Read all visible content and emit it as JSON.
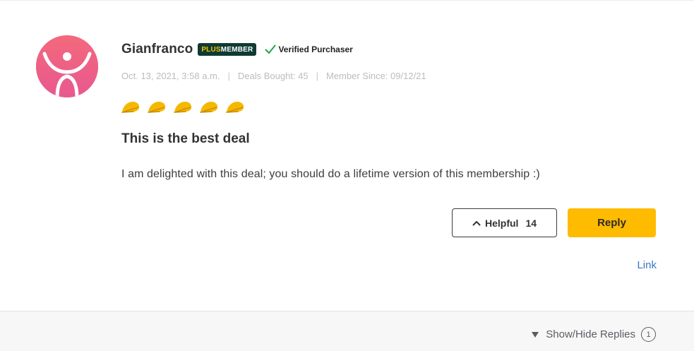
{
  "review": {
    "author": "Gianfranco",
    "badge": {
      "plus": "PLUS",
      "member": "MEMBER"
    },
    "verified_label": "Verified Purchaser",
    "meta": {
      "date": "Oct. 13, 2021, 3:58 a.m.",
      "separator": "|",
      "deals_bought": "Deals Bought: 45",
      "member_since": "Member Since: 09/12/21"
    },
    "rating": {
      "value": 5,
      "max": 5,
      "icon": "taco-icon"
    },
    "title": "This is the best deal",
    "body": "I am delighted with this deal; you should do a lifetime version of this membership :)"
  },
  "actions": {
    "helpful_label": "Helpful",
    "helpful_count": "14",
    "reply_label": "Reply",
    "link_label": "Link"
  },
  "footer": {
    "toggle_label": "Show/Hide Replies",
    "reply_count": "1"
  },
  "colors": {
    "avatar": "#f06a80",
    "badge_bg": "#0e3b34",
    "badge_plus": "#f5c400",
    "verified_check": "#1fa64a",
    "taco": "#f5b800",
    "reply_button": "#ffbb00",
    "link": "#3578c6"
  }
}
